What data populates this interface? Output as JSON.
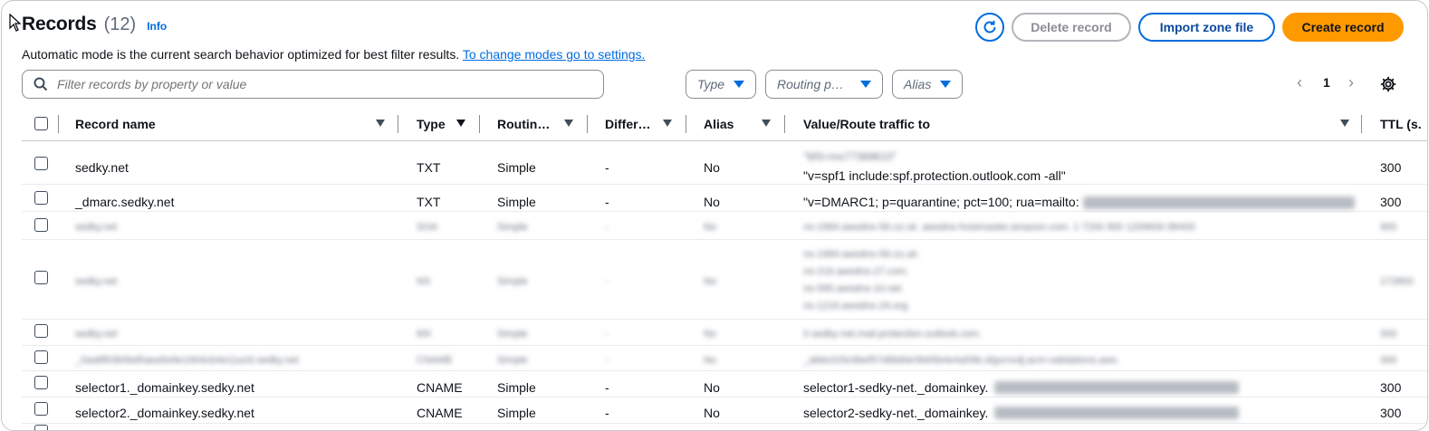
{
  "header": {
    "title": "Records",
    "count": "(12)",
    "info_label": "Info",
    "description": "Automatic mode is the current search behavior optimized for best filter results.",
    "settings_link": "To change modes go to settings."
  },
  "toolbar": {
    "delete_label": "Delete record",
    "import_label": "Import zone file",
    "create_label": "Create record"
  },
  "filters": {
    "search_placeholder": "Filter records by property or value",
    "type_label": "Type",
    "routing_label": "Routing p…",
    "alias_label": "Alias"
  },
  "pagination": {
    "page": "1"
  },
  "columns": {
    "record_name": "Record name",
    "type": "Type",
    "routing": "Routin…",
    "differ": "Differ…",
    "alias": "Alias",
    "value": "Value/Route traffic to",
    "ttl": "TTL (s."
  },
  "rows": [
    {
      "name": "sedky.net",
      "type": "TXT",
      "routing": "Simple",
      "differ": "-",
      "alias": "No",
      "value_line1": "\"MS=ms77389610\"",
      "value_line2": "\"v=spf1 include:spf.protection.outlook.com -all\"",
      "ttl": "300"
    },
    {
      "name": "_dmarc.sedky.net",
      "type": "TXT",
      "routing": "Simple",
      "differ": "-",
      "alias": "No",
      "value": "\"v=DMARC1; p=quarantine; pct=100; rua=mailto:",
      "ttl": "300"
    },
    {
      "name": "sedky.net",
      "type": "SOA",
      "routing": "Simple",
      "differ": "-",
      "alias": "No",
      "value": "ns-1984.awsdns-56.co.uk. awsdns-hostmaster.amazon.com. 1 7200 900 1209600 86400",
      "ttl": "900"
    },
    {
      "name": "sedky.net",
      "type": "NS",
      "routing": "Simple",
      "differ": "-",
      "alias": "No",
      "values": [
        "ns-1984.awsdns-56.co.uk.",
        "ns-216.awsdns-27.com.",
        "ns-595.awsdns-10.net.",
        "ns-1216.awsdns-24.org."
      ],
      "ttl": "172800"
    },
    {
      "name": "sedky.net",
      "type": "MX",
      "routing": "Simple",
      "differ": "-",
      "alias": "No",
      "value": "0 sedky-net.mail.protection.outlook.com.",
      "ttl": "300"
    },
    {
      "name": "_0aa8f63b0bd5aea5e9e1904cb4e11a16.sedky.net",
      "type": "CNAME",
      "routing": "Simple",
      "differ": "-",
      "alias": "No",
      "value": "_a8dc029c6bef57d6b8dc5b65b4e4a59b.sfgxrnvdj.acm-validations.aws.",
      "ttl": "300"
    },
    {
      "name": "selector1._domainkey.sedky.net",
      "type": "CNAME",
      "routing": "Simple",
      "differ": "-",
      "alias": "No",
      "value": "selector1-sedky-net._domainkey.",
      "ttl": "300"
    },
    {
      "name": "selector2._domainkey.sedky.net",
      "type": "CNAME",
      "routing": "Simple",
      "differ": "-",
      "alias": "No",
      "value": "selector2-sedky-net._domainkey.",
      "ttl": "300"
    }
  ]
}
